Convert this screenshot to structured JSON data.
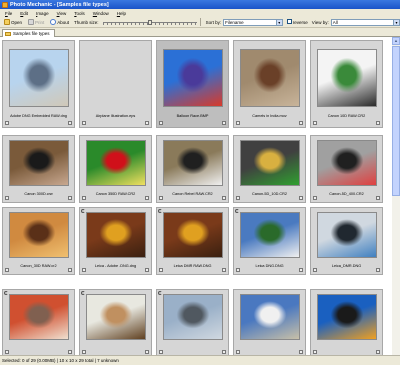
{
  "window": {
    "title": "Photo Mechanic - [Samples file types]"
  },
  "menu": [
    "File",
    "Edit",
    "Image",
    "View",
    "Tools",
    "Window",
    "Help"
  ],
  "toolbar": {
    "open_label": "Open",
    "print_label": "Print",
    "about_label": "About",
    "thumb_size_label": "Thumb size:",
    "thumb_size_level": 0.5,
    "sort_by_label": "Sort by:",
    "sort_by_value": "Filename",
    "reverse_label": "reverse",
    "view_by_label": "View by:",
    "view_by_value": "All"
  },
  "tabs": [
    {
      "label": "Samples file types"
    }
  ],
  "thumbnails": [
    {
      "caption": "Adobe DNG  Embedded RAW.dng",
      "colors": [
        "#b8d4ee",
        "#5d6f86",
        "#d0c8b8"
      ]
    },
    {
      "caption": "Airplane Illustration.eps",
      "colors": [
        "#d6d6d6",
        "#d6d6d6",
        "#d6d6d6"
      ],
      "empty": true
    },
    {
      "caption": "Balloon Race.BMP",
      "colors": [
        "#2b70d6",
        "#4a3a9a",
        "#d83a2a"
      ]
    },
    {
      "caption": "Camels in India.mov",
      "colors": [
        "#a08a6e",
        "#6a4028",
        "#c8b49a"
      ]
    },
    {
      "caption": "Canon 10D RAW.CR2",
      "colors": [
        "#f4f4f4",
        "#3a8a3a",
        "#2a2a2a"
      ]
    },
    {
      "caption": "Canon 300D.crw",
      "colors": [
        "#7a5a3a",
        "#1a1a1a",
        "#c8a890"
      ]
    },
    {
      "caption": "Canon 350D RAW.CR2",
      "colors": [
        "#2a8a2a",
        "#d0101a",
        "#f0e060"
      ]
    },
    {
      "caption": "Canon Rebel RAW.CR2",
      "colors": [
        "#8a7a5a",
        "#202020",
        "#f0f0f0"
      ]
    },
    {
      "caption": "Canon-5D_10D.CR2",
      "colors": [
        "#404040",
        "#d8b040",
        "#30a030"
      ]
    },
    {
      "caption": "Canon-5D_400.CR2",
      "colors": [
        "#a0a0a0",
        "#202020",
        "#e04040"
      ]
    },
    {
      "caption": "Canon_30D RAW.cr2",
      "colors": [
        "#d08a40",
        "#5a3018",
        "#f0c070"
      ]
    },
    {
      "caption": "Leica - Adobe .DNG.dng",
      "colors": [
        "#7a3a1a",
        "#e0a020",
        "#3a2010"
      ]
    },
    {
      "caption": "Leica DMR RAW.DNG",
      "colors": [
        "#7a3a1a",
        "#e0a020",
        "#3a2010"
      ]
    },
    {
      "caption": "Leica DNG.DNG",
      "colors": [
        "#4a7ac0",
        "#2a6a2a",
        "#f0f0f0"
      ]
    },
    {
      "caption": "Leica_DMR.DNG",
      "colors": [
        "#d0d8e0",
        "#202830",
        "#4080c0"
      ]
    },
    {
      "caption": "",
      "colors": [
        "#d05030",
        "#806050",
        "#f0e0d0"
      ]
    },
    {
      "caption": "",
      "colors": [
        "#e8e8e0",
        "#c09060",
        "#604020"
      ]
    },
    {
      "caption": "",
      "colors": [
        "#9ab0c8",
        "#505860",
        "#d0d8e0"
      ]
    },
    {
      "caption": "",
      "colors": [
        "#4a78c0",
        "#f0f0f0",
        "#c8c0a8"
      ]
    },
    {
      "caption": "",
      "colors": [
        "#1a60c0",
        "#1a1a1a",
        "#f0a020"
      ]
    }
  ],
  "status": {
    "text": "Selected: 0 of 29 (0.00MB) | 10 x 10 x 29 total | 7 unknown"
  }
}
